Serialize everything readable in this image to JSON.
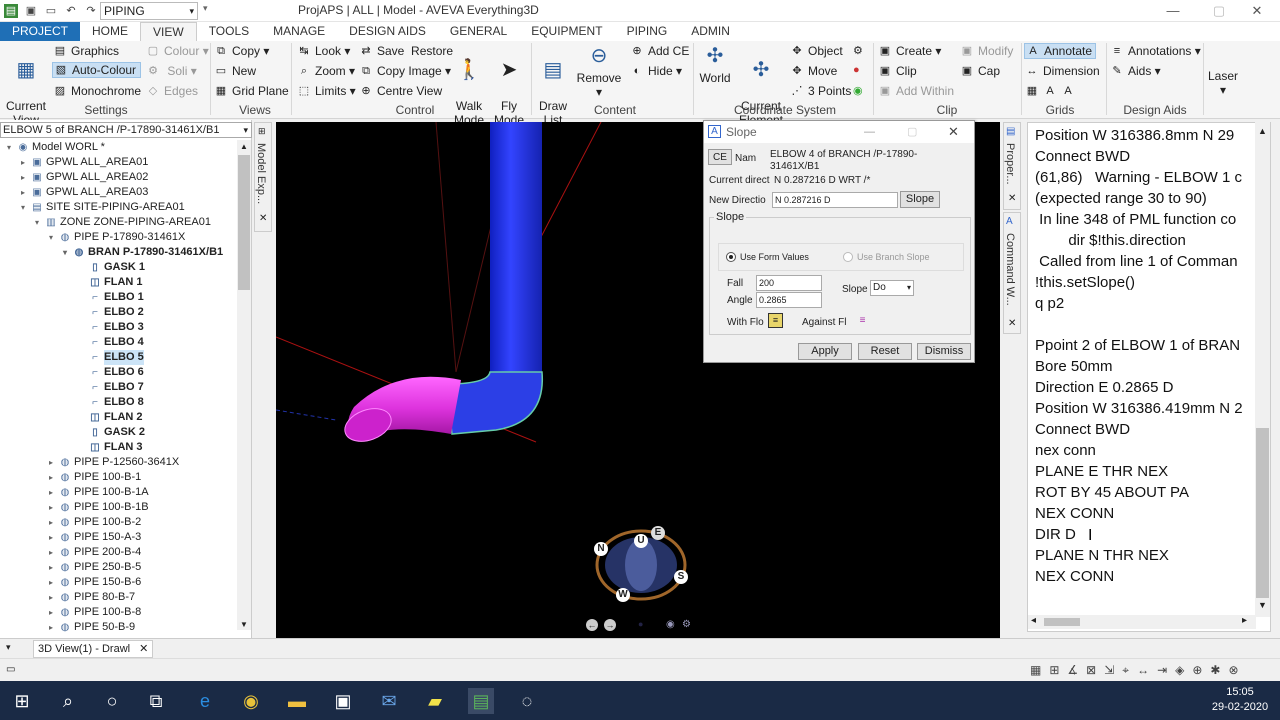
{
  "window": {
    "title": "ProjAPS | ALL | Model - AVEVA Everything3D",
    "module": "PIPING"
  },
  "tabs": [
    "PROJECT",
    "HOME",
    "VIEW",
    "TOOLS",
    "MANAGE",
    "DESIGN AIDS",
    "GENERAL",
    "EQUIPMENT",
    "PIPING",
    "ADMIN"
  ],
  "ribbon": {
    "current_view": "Current\nView",
    "graphics": "Graphics",
    "auto_colour": "Auto-Colour",
    "monochrome": "Monochrome",
    "colour": "Colour",
    "soli": "Soli",
    "edges": "Edges",
    "settings": "Settings",
    "copy": "Copy",
    "new": "New",
    "grid_plane": "Grid Plane",
    "views": "Views",
    "look": "Look",
    "zoom": "Zoom",
    "limits": "Limits",
    "save_restore": "Save",
    "restore": "Restore",
    "copy_image": "Copy Image",
    "centre_view": "Centre View",
    "walk_mode": "Walk\nMode",
    "fly_mode": "Fly\nMode",
    "control": "Control",
    "draw_list": "Draw\nList",
    "remove": "Remove",
    "add_ce": "Add CE",
    "hide": "Hide",
    "content": "Content",
    "world": "World",
    "current_element": "Current\nElement",
    "object": "Object",
    "move": "Move",
    "three_points": "3 Points",
    "coordinate_system": "Coordinate System",
    "create": "Create",
    "clip": "Clip",
    "add_within": "Add Within",
    "modify": "Modify",
    "cap": "Cap",
    "clip_group": "Clip",
    "annotate": "Annotate",
    "dimension": "Dimension",
    "grids": "Grids",
    "annotations": "Annotations",
    "aids": "Aids",
    "design_aids": "Design Aids",
    "laser": "Laser"
  },
  "explorer": {
    "ce_path": "ELBOW 5 of BRANCH /P-17890-31461X/B1",
    "panel_label": "Model Exp...",
    "items": [
      {
        "label": "Model WORL *",
        "level": 0,
        "toggle": "▾",
        "icon": "◉"
      },
      {
        "label": "GPWL ALL_AREA01",
        "level": 1,
        "toggle": "▸",
        "icon": "▣"
      },
      {
        "label": "GPWL ALL_AREA02",
        "level": 1,
        "toggle": "▸",
        "icon": "▣"
      },
      {
        "label": "GPWL ALL_AREA03",
        "level": 1,
        "toggle": "▸",
        "icon": "▣"
      },
      {
        "label": "SITE SITE-PIPING-AREA01",
        "level": 1,
        "toggle": "▾",
        "icon": "▤"
      },
      {
        "label": "ZONE ZONE-PIPING-AREA01",
        "level": 2,
        "toggle": "▾",
        "icon": "▥"
      },
      {
        "label": "PIPE P-17890-31461X",
        "level": 3,
        "toggle": "▾",
        "icon": "◍"
      },
      {
        "label": "BRAN P-17890-31461X/B1",
        "level": 4,
        "toggle": "▾",
        "icon": "◍",
        "bold": true
      },
      {
        "label": "GASK 1",
        "level": 5,
        "toggle": "",
        "icon": "▯",
        "bold": true
      },
      {
        "label": "FLAN 1",
        "level": 5,
        "toggle": "",
        "icon": "◫",
        "bold": true
      },
      {
        "label": "ELBO 1",
        "level": 5,
        "toggle": "",
        "icon": "⌐",
        "bold": true
      },
      {
        "label": "ELBO 2",
        "level": 5,
        "toggle": "",
        "icon": "⌐",
        "bold": true
      },
      {
        "label": "ELBO 3",
        "level": 5,
        "toggle": "",
        "icon": "⌐",
        "bold": true
      },
      {
        "label": "ELBO 4",
        "level": 5,
        "toggle": "",
        "icon": "⌐",
        "bold": true
      },
      {
        "label": "ELBO 5",
        "level": 5,
        "toggle": "",
        "icon": "⌐",
        "bold": true,
        "selected": true
      },
      {
        "label": "ELBO 6",
        "level": 5,
        "toggle": "",
        "icon": "⌐",
        "bold": true
      },
      {
        "label": "ELBO 7",
        "level": 5,
        "toggle": "",
        "icon": "⌐",
        "bold": true
      },
      {
        "label": "ELBO 8",
        "level": 5,
        "toggle": "",
        "icon": "⌐",
        "bold": true
      },
      {
        "label": "FLAN 2",
        "level": 5,
        "toggle": "",
        "icon": "◫",
        "bold": true
      },
      {
        "label": "GASK 2",
        "level": 5,
        "toggle": "",
        "icon": "▯",
        "bold": true
      },
      {
        "label": "FLAN 3",
        "level": 5,
        "toggle": "",
        "icon": "◫",
        "bold": true
      },
      {
        "label": "PIPE P-12560-3641X",
        "level": 3,
        "toggle": "▸",
        "icon": "◍"
      },
      {
        "label": "PIPE 100-B-1",
        "level": 3,
        "toggle": "▸",
        "icon": "◍"
      },
      {
        "label": "PIPE 100-B-1A",
        "level": 3,
        "toggle": "▸",
        "icon": "◍"
      },
      {
        "label": "PIPE 100-B-1B",
        "level": 3,
        "toggle": "▸",
        "icon": "◍"
      },
      {
        "label": "PIPE 100-B-2",
        "level": 3,
        "toggle": "▸",
        "icon": "◍"
      },
      {
        "label": "PIPE 150-A-3",
        "level": 3,
        "toggle": "▸",
        "icon": "◍"
      },
      {
        "label": "PIPE 200-B-4",
        "level": 3,
        "toggle": "▸",
        "icon": "◍"
      },
      {
        "label": "PIPE 250-B-5",
        "level": 3,
        "toggle": "▸",
        "icon": "◍"
      },
      {
        "label": "PIPE 150-B-6",
        "level": 3,
        "toggle": "▸",
        "icon": "◍"
      },
      {
        "label": "PIPE 80-B-7",
        "level": 3,
        "toggle": "▸",
        "icon": "◍"
      },
      {
        "label": "PIPE 100-B-8",
        "level": 3,
        "toggle": "▸",
        "icon": "◍"
      },
      {
        "label": "PIPE 50-B-9",
        "level": 3,
        "toggle": "▸",
        "icon": "◍"
      }
    ]
  },
  "slope_dialog": {
    "title": "Slope",
    "ce_label": "CE",
    "name_label": "Nam",
    "name_value": "ELBOW 4 of BRANCH /P-17890-31461X/B1",
    "current_dir_label": "Current direct",
    "current_dir_value": "N 0.287216 D WRT /*",
    "new_dir_label": "New Directio",
    "new_dir_value": "N 0.287216 D",
    "slope_button": "Slope",
    "group_label": "Slope",
    "use_form_values": "Use Form Values",
    "use_branch_slope": "Use Branch Slope",
    "fall_label": "Fall",
    "fall_value": "200",
    "angle_label": "Angle",
    "angle_value": "0.2865",
    "slope_label": "Slope",
    "slope_select": "Do",
    "with_flow": "With Flo",
    "against_flow": "Against Fl",
    "apply": "Apply",
    "reset": "Reset",
    "dismiss": "Dismiss"
  },
  "side_tabs": {
    "properties": "Proper...",
    "command_window": "Command W..."
  },
  "console_lines": [
    "Position W 316386.8mm N 29",
    "Connect BWD",
    "(61,86)   Warning - ELBOW 1 c",
    "(expected range 30 to 90)",
    " In line 348 of PML function co",
    "        dir $!this.direction",
    " Called from line 1 of Comman",
    "!this.setSlope()",
    "q p2",
    "",
    "Ppoint 2 of ELBOW 1 of BRAN",
    "Bore 50mm",
    "Direction E 0.2865 D",
    "Position W 316386.419mm N 2",
    "Connect BWD",
    "nex conn",
    "PLANE E THR NEX",
    "ROT BY 45 ABOUT PA",
    "NEX CONN",
    "DIR D",
    "PLANE N THR NEX",
    "NEX CONN"
  ],
  "compass": {
    "n": "N",
    "s": "S",
    "w": "W",
    "e": "E",
    "u": "U"
  },
  "doc_tab": "3D View(1) - Drawl",
  "taskbar": {
    "time": "15:05",
    "date": "29-02-2020"
  },
  "colors": {
    "pipe_blue": "#2233ee",
    "pipe_magenta": "#dd33dd",
    "accent": "#1f6fb6"
  }
}
